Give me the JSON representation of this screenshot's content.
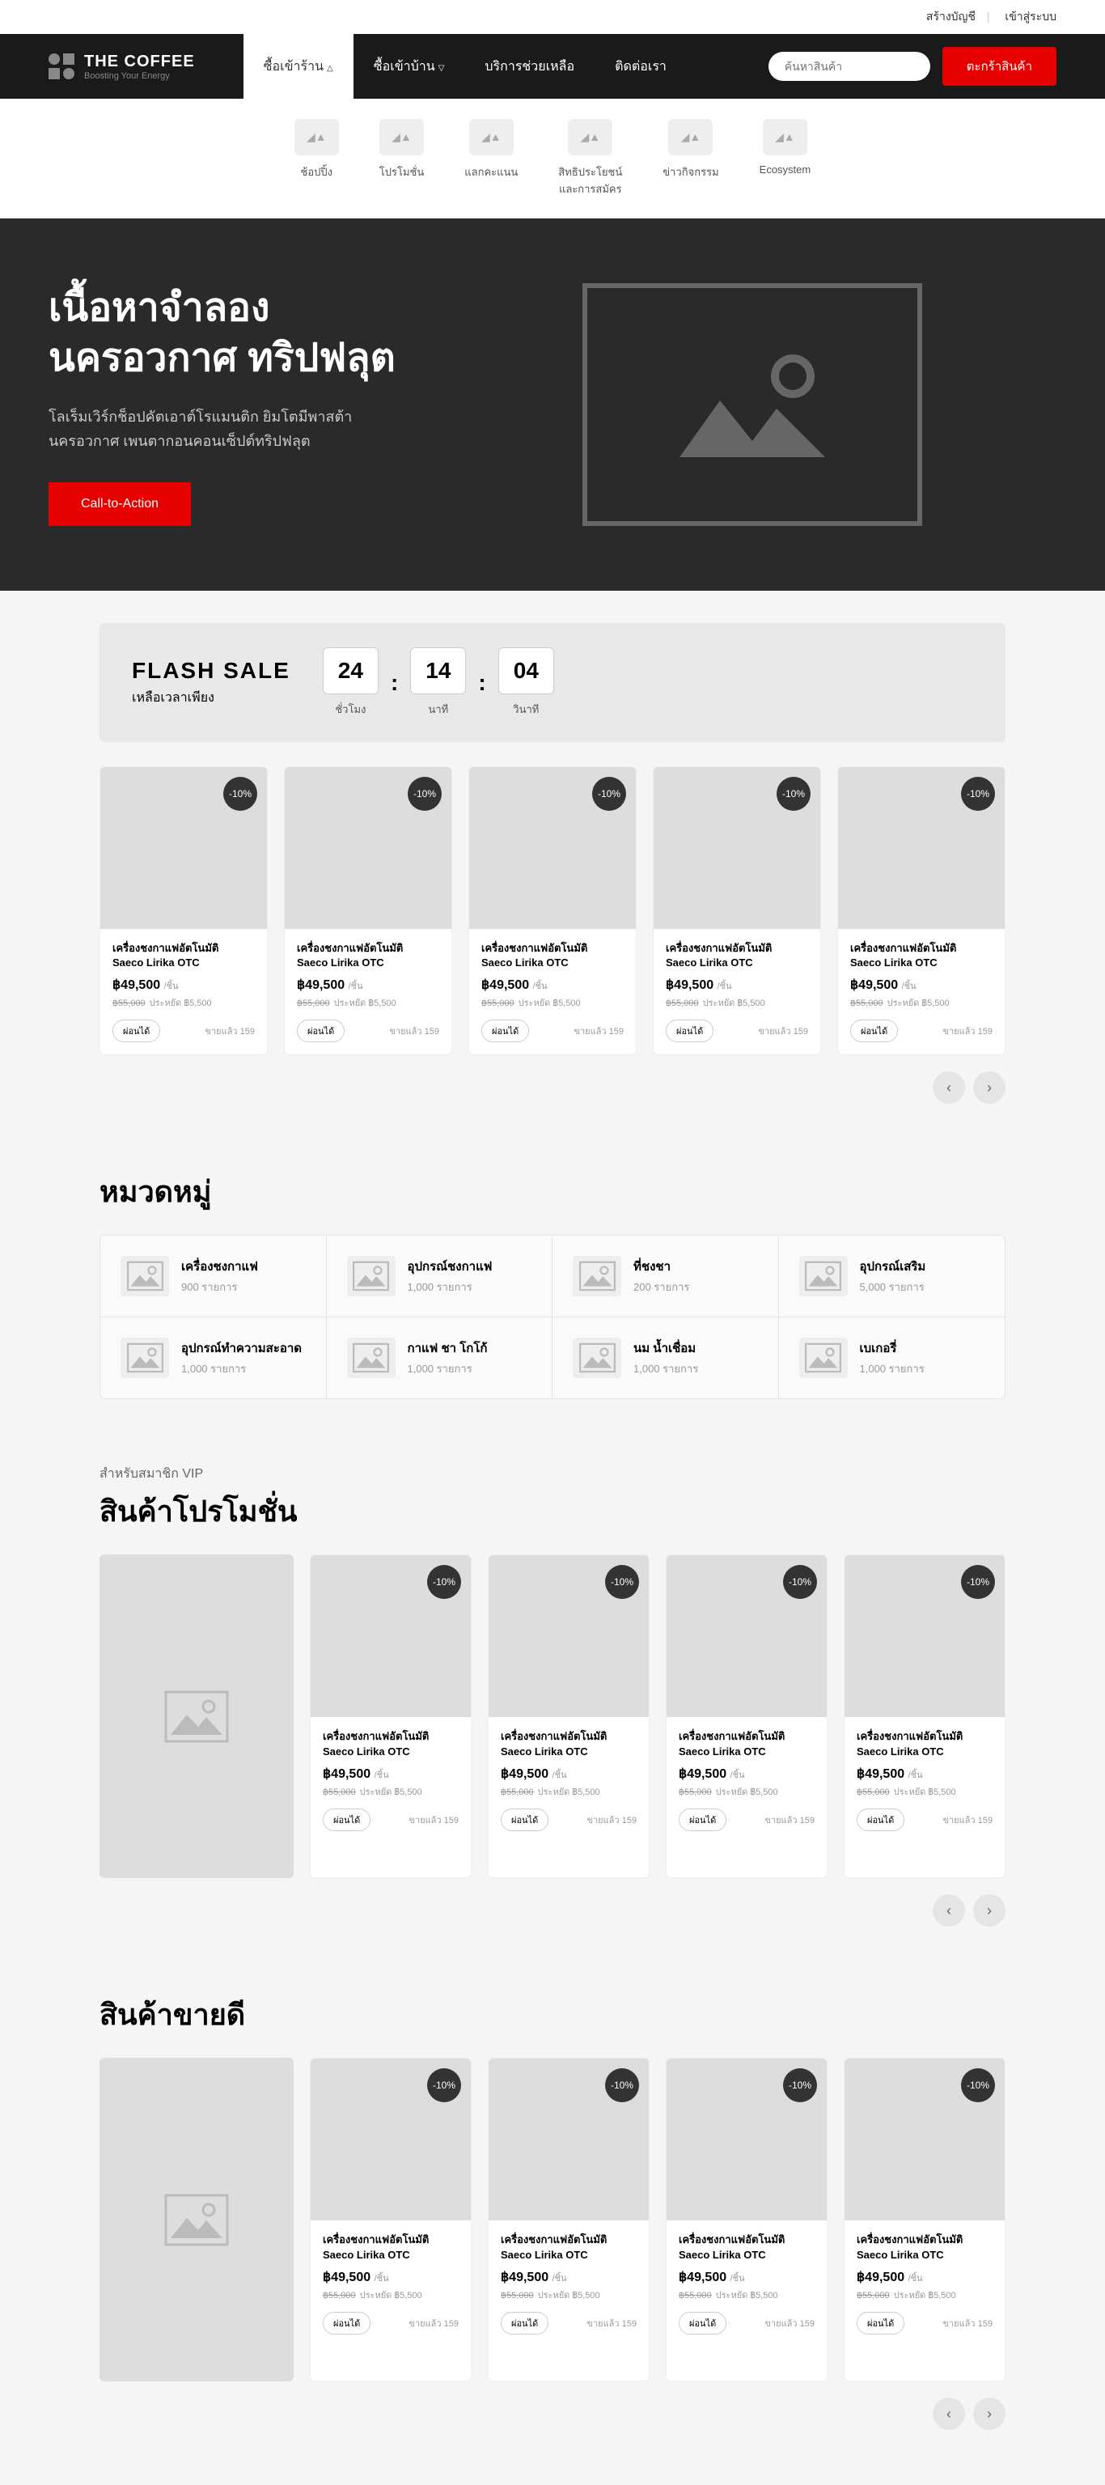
{
  "topbar": {
    "create": "สร้างบัญชี",
    "login": "เข้าสู่ระบบ"
  },
  "logo": {
    "title": "THE COFFEE",
    "sub": "Boosting Your Energy"
  },
  "nav": [
    {
      "label": "ซื้อเข้าร้าน",
      "arrow": "△",
      "active": true
    },
    {
      "label": "ซื้อเข้าบ้าน",
      "arrow": "▽"
    },
    {
      "label": "บริการช่วยเหลือ"
    },
    {
      "label": "ติดต่อเรา"
    }
  ],
  "search": {
    "placeholder": "ค้นหาสินค้า",
    "button": "ตะกร้าสินค้า"
  },
  "subnav": [
    {
      "label": "ช้อปปิ้ง"
    },
    {
      "label": "โปรโมชั่น"
    },
    {
      "label": "แลกคะแนน"
    },
    {
      "label": "สิทธิประโยชน์\nและการสมัคร"
    },
    {
      "label": "ข่าวกิจกรรม"
    },
    {
      "label": "Ecosystem"
    }
  ],
  "hero": {
    "title": "เนื้อหาจำลอง\nนครอวกาศ ทริปฟลุต",
    "desc": "โลเร็มเวิร์กช็อปคัตเอาต์โรแมนติก ยิมโตมีพาสต้า\nนครอวกาศ เพนตากอนคอนเซ็ปต์ทริปฟลุต",
    "cta": "Call-to-Action"
  },
  "flash": {
    "title": "FLASH SALE",
    "sub": "เหลือเวลาเพียง",
    "hours": "24",
    "hoursLabel": "ชั่วโมง",
    "mins": "14",
    "minsLabel": "นาที",
    "secs": "04",
    "secsLabel": "วินาที"
  },
  "product": {
    "badge": "-10%",
    "name": "เครื่องชงกาแฟอัตโนมัติ\nSaeco Lirika OTC",
    "price": "฿49,500",
    "unit": "/ชิ้น",
    "oldPrice": "฿55,000",
    "savings": "ประหยัด ฿5,500",
    "compare": "ผ่อนได้",
    "sold": "ขายแล้ว 159"
  },
  "categories": {
    "title": "หมวดหมู่",
    "items": [
      {
        "name": "เครื่องชงกาแฟ",
        "count": "900 รายการ"
      },
      {
        "name": "อุปกรณ์ชงกาแฟ",
        "count": "1,000 รายการ"
      },
      {
        "name": "ที่ชงชา",
        "count": "200 รายการ"
      },
      {
        "name": "อุปกรณ์เสริม",
        "count": "5,000 รายการ"
      },
      {
        "name": "อุปกรณ์ทำความสะอาด",
        "count": "1,000 รายการ"
      },
      {
        "name": "กาแฟ ชา โกโก้",
        "count": "1,000 รายการ"
      },
      {
        "name": "นม น้ำเชื่อม",
        "count": "1,000 รายการ"
      },
      {
        "name": "เบเกอรี่",
        "count": "1,000 รายการ"
      }
    ]
  },
  "promo": {
    "sub": "สำหรับสมาชิก VIP",
    "title": "สินค้าโปรโมชั่น"
  },
  "bestseller": {
    "title": "สินค้าขายดี"
  }
}
